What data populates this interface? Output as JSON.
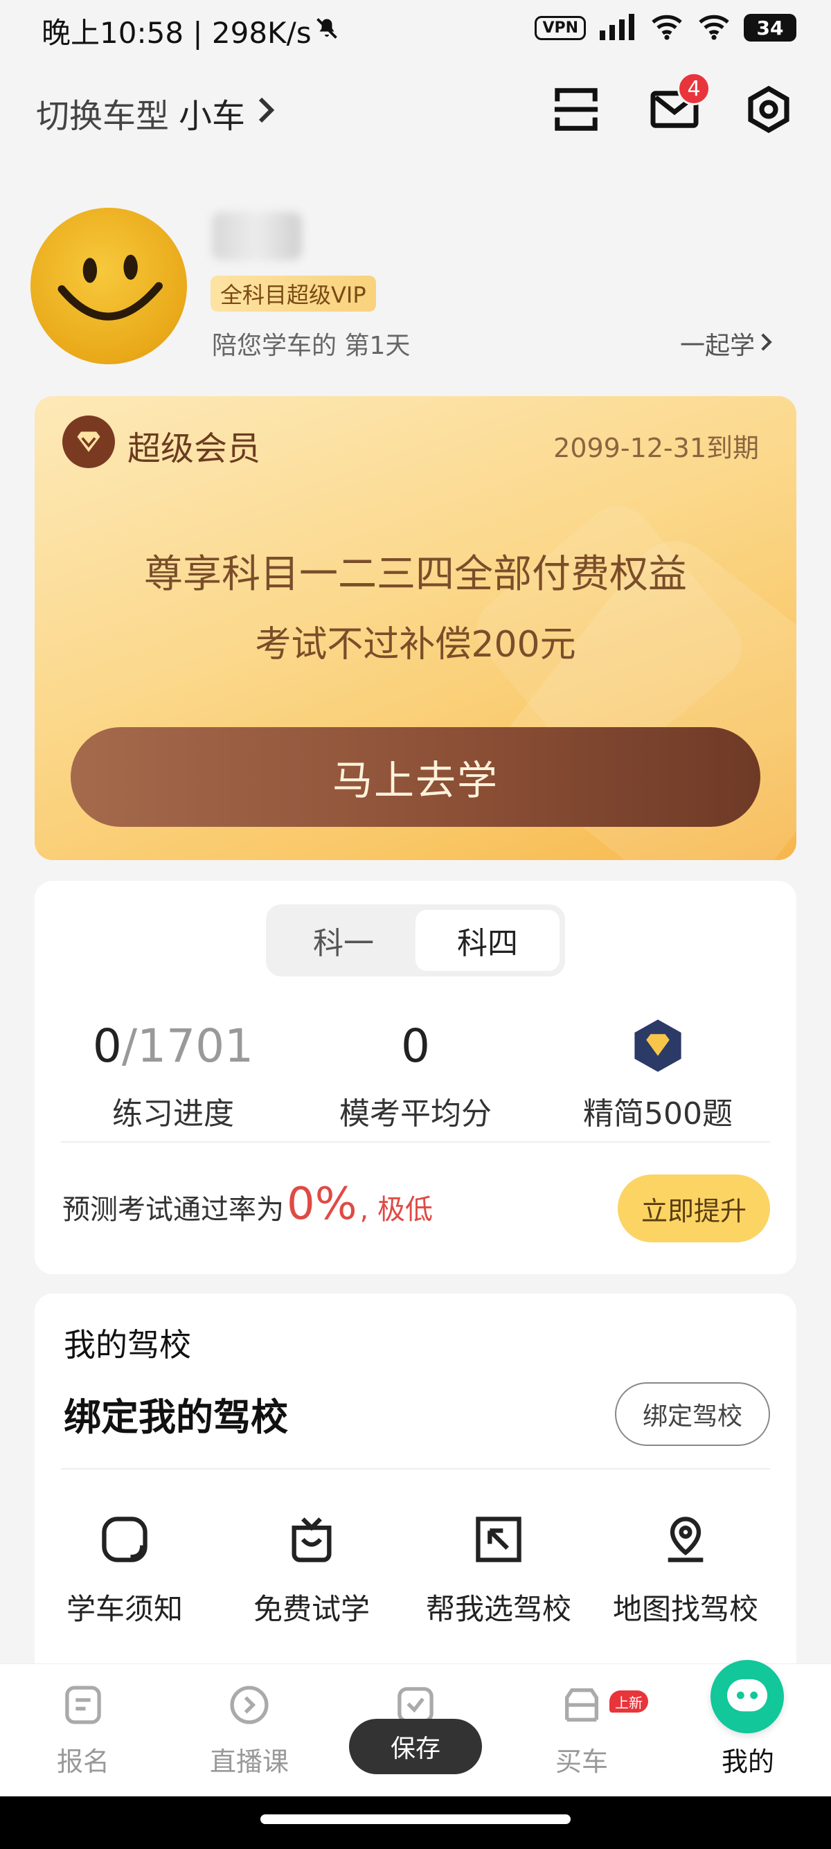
{
  "status_bar": {
    "time_speed": "晚上10:58 | 298K/s",
    "vpn": "VPN",
    "battery": "34"
  },
  "header": {
    "switch_label": "切换车型",
    "car_type": "小车",
    "mail_badge": "4"
  },
  "profile": {
    "vip_tag": "全科目超级VIP",
    "days_text": "陪您学车的 第1天",
    "study_together": "一起学"
  },
  "vip_card": {
    "title": "超级会员",
    "expiry": "2099-12-31到期",
    "line1": "尊享科目一二三四全部付费权益",
    "line2": "考试不过补偿200元",
    "button": "马上去学"
  },
  "stats": {
    "tabs": [
      "科一",
      "科四"
    ],
    "active_tab": "科四",
    "progress_done": "0",
    "progress_total": "/1701",
    "progress_label": "练习进度",
    "avg_score": "0",
    "avg_label": "模考平均分",
    "select_label": "精简500题",
    "predict_text": "预测考试通过率为",
    "predict_pct": "0%",
    "predict_level": ", 极低",
    "boost_button": "立即提升"
  },
  "school": {
    "title": "我的驾校",
    "bind_text": "绑定我的驾校",
    "bind_button": "绑定驾校",
    "quick": [
      {
        "label": "学车须知",
        "icon": "notice-icon"
      },
      {
        "label": "免费试学",
        "icon": "trial-icon"
      },
      {
        "label": "帮我选驾校",
        "icon": "choose-school-icon"
      },
      {
        "label": "地图找驾校",
        "icon": "map-pin-icon"
      }
    ]
  },
  "bottom_nav": {
    "items": [
      {
        "label": "报名",
        "icon": "signup-icon"
      },
      {
        "label": "直播课",
        "icon": "live-icon"
      },
      {
        "label": "",
        "icon": "practice-icon"
      },
      {
        "label": "买车",
        "icon": "car-icon"
      },
      {
        "label": "我的",
        "icon": "me-icon"
      }
    ],
    "new_badge": "上新",
    "active": "我的"
  },
  "toast": "保存",
  "colors": {
    "accent_green": "#12c79a",
    "vip_brown": "#8a4e35",
    "warning_red": "#e04a44",
    "boost_yellow": "#fbd463"
  }
}
